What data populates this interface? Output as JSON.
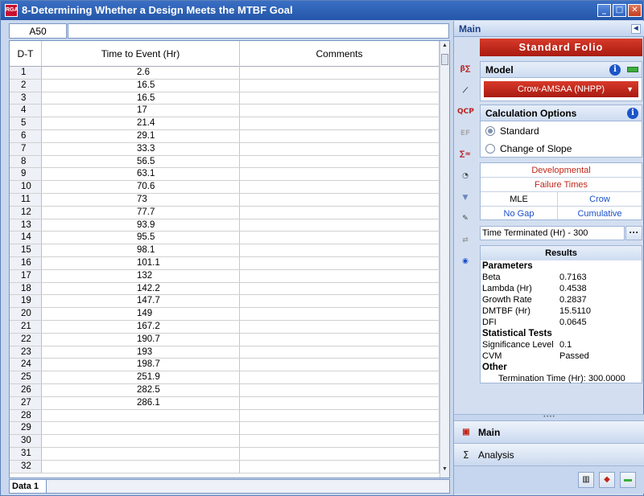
{
  "window": {
    "title": "8-Determining Whether a Design Meets the MTBF Goal",
    "app_icon_text": "RGA"
  },
  "grid": {
    "cell_ref": "A50",
    "headers": [
      "D-T",
      "Time to Event (Hr)",
      "Comments"
    ],
    "rows": [
      {
        "n": "1",
        "t": "2.6"
      },
      {
        "n": "2",
        "t": "16.5"
      },
      {
        "n": "3",
        "t": "16.5"
      },
      {
        "n": "4",
        "t": "17"
      },
      {
        "n": "5",
        "t": "21.4"
      },
      {
        "n": "6",
        "t": "29.1"
      },
      {
        "n": "7",
        "t": "33.3"
      },
      {
        "n": "8",
        "t": "56.5"
      },
      {
        "n": "9",
        "t": "63.1"
      },
      {
        "n": "10",
        "t": "70.6"
      },
      {
        "n": "11",
        "t": "73"
      },
      {
        "n": "12",
        "t": "77.7"
      },
      {
        "n": "13",
        "t": "93.9"
      },
      {
        "n": "14",
        "t": "95.5"
      },
      {
        "n": "15",
        "t": "98.1"
      },
      {
        "n": "16",
        "t": "101.1"
      },
      {
        "n": "17",
        "t": "132"
      },
      {
        "n": "18",
        "t": "142.2"
      },
      {
        "n": "19",
        "t": "147.7"
      },
      {
        "n": "20",
        "t": "149"
      },
      {
        "n": "21",
        "t": "167.2"
      },
      {
        "n": "22",
        "t": "190.7"
      },
      {
        "n": "23",
        "t": "193"
      },
      {
        "n": "24",
        "t": "198.7"
      },
      {
        "n": "25",
        "t": "251.9"
      },
      {
        "n": "26",
        "t": "282.5"
      },
      {
        "n": "27",
        "t": "286.1"
      },
      {
        "n": "28",
        "t": ""
      },
      {
        "n": "29",
        "t": ""
      },
      {
        "n": "30",
        "t": ""
      },
      {
        "n": "31",
        "t": ""
      },
      {
        "n": "32",
        "t": ""
      }
    ],
    "sheet_tab": "Data 1"
  },
  "panel": {
    "header": "Main",
    "folio_title": "Standard Folio",
    "model": {
      "label": "Model",
      "selected": "Crow-AMSAA (NHPP)"
    },
    "calc": {
      "label": "Calculation Options",
      "option1": "Standard",
      "option2": "Change of Slope",
      "selected": "Standard"
    },
    "settings": {
      "developmental": "Developmental",
      "failure_times": "Failure Times",
      "mle": "MLE",
      "crow": "Crow",
      "no_gap": "No Gap",
      "cumulative": "Cumulative"
    },
    "time_terminated": "Time Terminated (Hr) - 300",
    "results": {
      "title": "Results",
      "parameters_label": "Parameters",
      "params": [
        {
          "name": "Beta",
          "value": "0.7163"
        },
        {
          "name": "Lambda (Hr)",
          "value": "0.4538"
        },
        {
          "name": "Growth Rate",
          "value": "0.2837"
        },
        {
          "name": "DMTBF (Hr)",
          "value": "15.5110"
        },
        {
          "name": "DFI",
          "value": "0.0645"
        }
      ],
      "stat_label": "Statistical Tests",
      "stats": [
        {
          "name": "Significance Level",
          "value": "0.1"
        },
        {
          "name": "CVM",
          "value": "Passed"
        }
      ],
      "other_label": "Other",
      "termination": "Termination Time (Hr): 300.0000"
    },
    "nav": {
      "main": "Main",
      "analysis": "Analysis"
    }
  },
  "colors": {
    "accent_red": "#c02618",
    "link_blue": "#1a4fc8",
    "title_blue": "#2456a8"
  }
}
